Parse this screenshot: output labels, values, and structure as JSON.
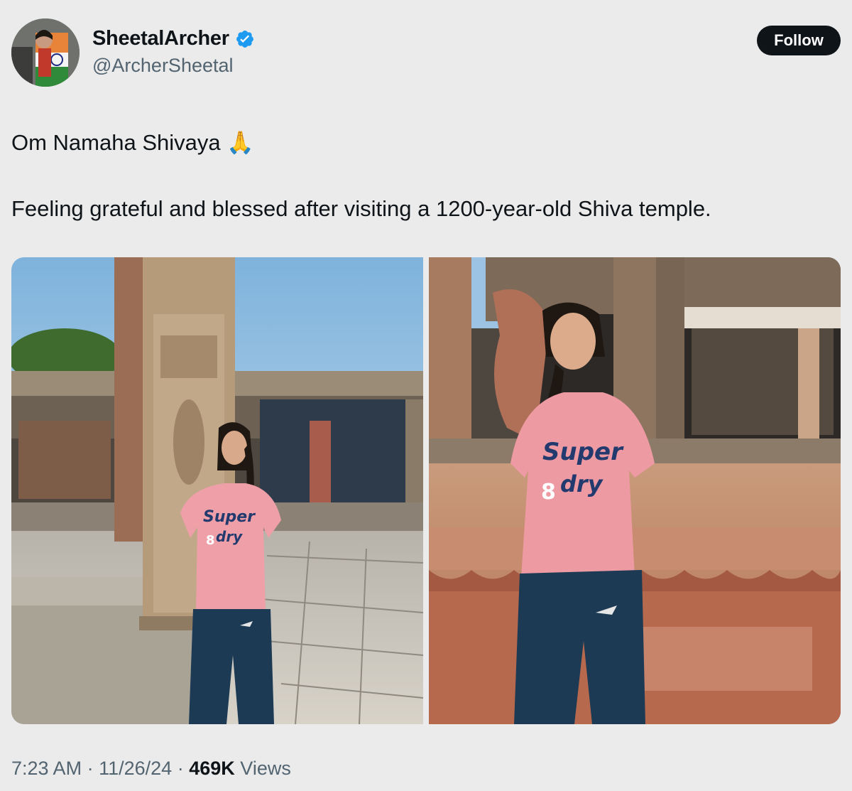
{
  "author": {
    "display_name": "SheetalArcher",
    "handle": "@ArcherSheetal",
    "verified_icon": "verified-badge-icon",
    "accent_color": "#1d9bf0"
  },
  "follow_button": {
    "label": "Follow"
  },
  "tweet": {
    "line1": "Om Namaha Shivaya 🙏",
    "line2": "Feeling grateful and blessed after visiting a 1200-year-old Shiva temple."
  },
  "media": {
    "photos": [
      {
        "shirt_text_top": "Super",
        "shirt_text_bottom": "dry",
        "shirt_digit": "8"
      },
      {
        "shirt_text_top": "Super",
        "shirt_text_bottom": "dry",
        "shirt_digit": "8"
      }
    ]
  },
  "meta": {
    "time": "7:23 AM",
    "date": "11/26/24",
    "views_count": "469K",
    "views_label": "Views",
    "separator": "·"
  }
}
